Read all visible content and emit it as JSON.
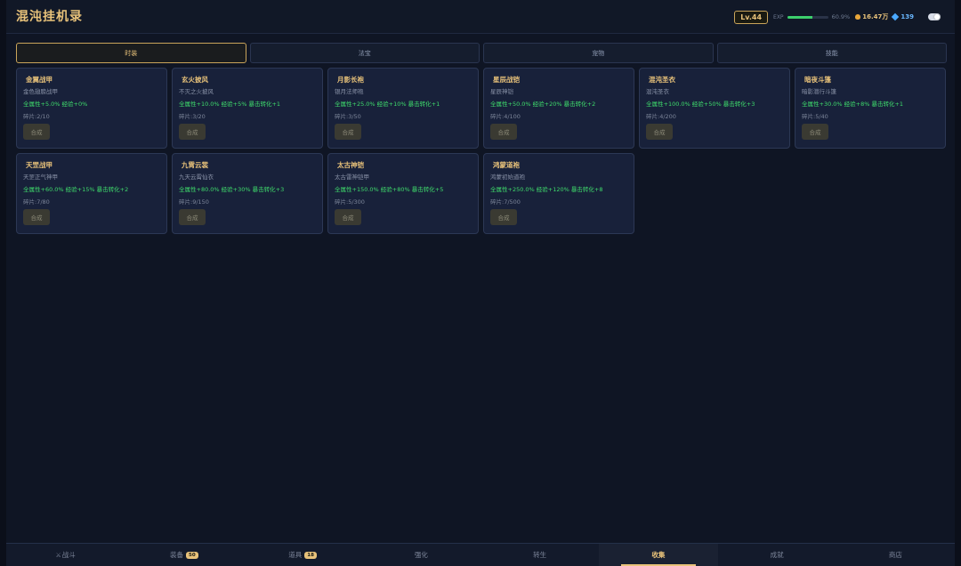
{
  "app": {
    "title": "混沌挂机录"
  },
  "header": {
    "level": "Lv.44",
    "exp_label": "EXP",
    "exp_percent": "60.9%",
    "exp_fraction": 0.609,
    "gold": "16.47万",
    "gems": "139",
    "gold_icon": "gold-coin-icon",
    "gem_icon": "diamond-icon"
  },
  "tabs": [
    {
      "label": "时装",
      "active": true
    },
    {
      "label": "法宝",
      "active": false
    },
    {
      "label": "宠物",
      "active": false
    },
    {
      "label": "技能",
      "active": false
    }
  ],
  "cards": [
    {
      "name": "金翼战甲",
      "sub": "金色翅膀战甲",
      "bonus": "全属性+5.0% 经验+0%",
      "frag": "碎片:2/10",
      "btn": "合成"
    },
    {
      "name": "玄火披风",
      "sub": "不灭之火披风",
      "bonus": "全属性+10.0% 经验+5% 暴击转化+1",
      "frag": "碎片:3/20",
      "btn": "合成"
    },
    {
      "name": "月影长袍",
      "sub": "银月法师袍",
      "bonus": "全属性+25.0% 经验+10% 暴击转化+1",
      "frag": "碎片:3/50",
      "btn": "合成"
    },
    {
      "name": "星辰战铠",
      "sub": "星辰神铠",
      "bonus": "全属性+50.0% 经验+20% 暴击转化+2",
      "frag": "碎片:4/100",
      "btn": "合成"
    },
    {
      "name": "混沌圣衣",
      "sub": "混沌圣衣",
      "bonus": "全属性+100.0% 经验+50% 暴击转化+3",
      "frag": "碎片:4/200",
      "btn": "合成"
    },
    {
      "name": "暗夜斗篷",
      "sub": "暗影潜行斗篷",
      "bonus": "全属性+30.0% 经验+8% 暴击转化+1",
      "frag": "碎片:5/40",
      "btn": "合成"
    },
    {
      "name": "天罡战甲",
      "sub": "天罡正气神甲",
      "bonus": "全属性+60.0% 经验+15% 暴击转化+2",
      "frag": "碎片:7/80",
      "btn": "合成"
    },
    {
      "name": "九霄云裳",
      "sub": "九天云霄仙衣",
      "bonus": "全属性+80.0% 经验+30% 暴击转化+3",
      "frag": "碎片:9/150",
      "btn": "合成"
    },
    {
      "name": "太古神铠",
      "sub": "太古雷神铠甲",
      "bonus": "全属性+150.0% 经验+80% 暴击转化+5",
      "frag": "碎片:5/300",
      "btn": "合成"
    },
    {
      "name": "鸿蒙道袍",
      "sub": "鸿蒙初始道袍",
      "bonus": "全属性+250.0% 经验+120% 暴击转化+8",
      "frag": "碎片:7/500",
      "btn": "合成"
    }
  ],
  "nav": [
    {
      "label": "战斗",
      "icon": "sword-icon",
      "badge": null,
      "active": false
    },
    {
      "label": "装备",
      "badge": "50",
      "active": false
    },
    {
      "label": "道具",
      "badge": "18",
      "active": false
    },
    {
      "label": "强化",
      "badge": null,
      "active": false
    },
    {
      "label": "转生",
      "badge": null,
      "active": false
    },
    {
      "label": "收集",
      "badge": null,
      "active": true
    },
    {
      "label": "成就",
      "badge": null,
      "active": false
    },
    {
      "label": "商店",
      "badge": null,
      "active": false
    }
  ]
}
